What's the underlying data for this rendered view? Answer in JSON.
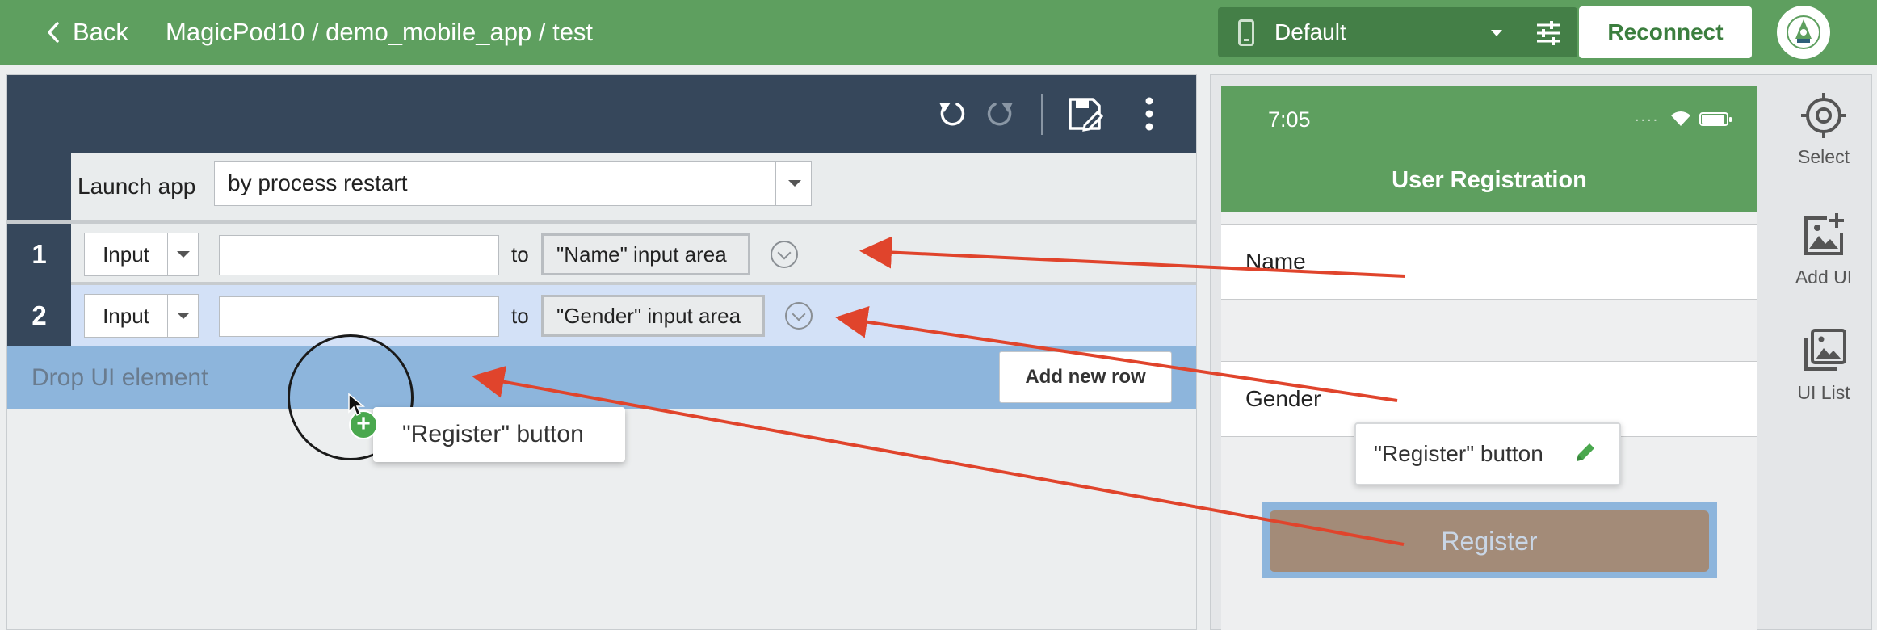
{
  "topbar": {
    "back_label": "Back",
    "breadcrumb": "MagicPod10 / demo_mobile_app / test",
    "device_name": "Default",
    "reconnect_label": "Reconnect"
  },
  "editor": {
    "launch": {
      "label": "Launch app",
      "mode": "by process restart"
    },
    "steps": [
      {
        "number": "1",
        "command": "Input",
        "value": "",
        "to_label": "to",
        "target": "\"Name\" input area"
      },
      {
        "number": "2",
        "command": "Input",
        "value": "",
        "to_label": "to",
        "target": "\"Gender\" input area"
      }
    ],
    "drop_placeholder": "Drop UI element",
    "add_row_label": "Add new row",
    "dragging_chip": "\"Register\" button"
  },
  "phone": {
    "time": "7:05",
    "app_title": "User Registration",
    "fields": [
      "Name",
      "Gender"
    ],
    "register_label": "Register",
    "tooltip": "\"Register\" button"
  },
  "tools": {
    "select": "Select",
    "add_ui": "Add UI",
    "ui_list": "UI List"
  },
  "colors": {
    "brand_green": "#5e9f5f",
    "toolbar_navy": "#36475b",
    "drop_blue": "#8db5dc",
    "arrow_red": "#e0442c"
  },
  "icons": [
    "chevron-left-icon",
    "phone-icon",
    "tune-icon",
    "robot-logo-icon",
    "undo-icon",
    "redo-icon",
    "save-icon",
    "more-vertical-icon",
    "crosshair-icon",
    "add-image-icon",
    "image-stack-icon",
    "pencil-icon",
    "plus-icon",
    "cursor-icon"
  ]
}
